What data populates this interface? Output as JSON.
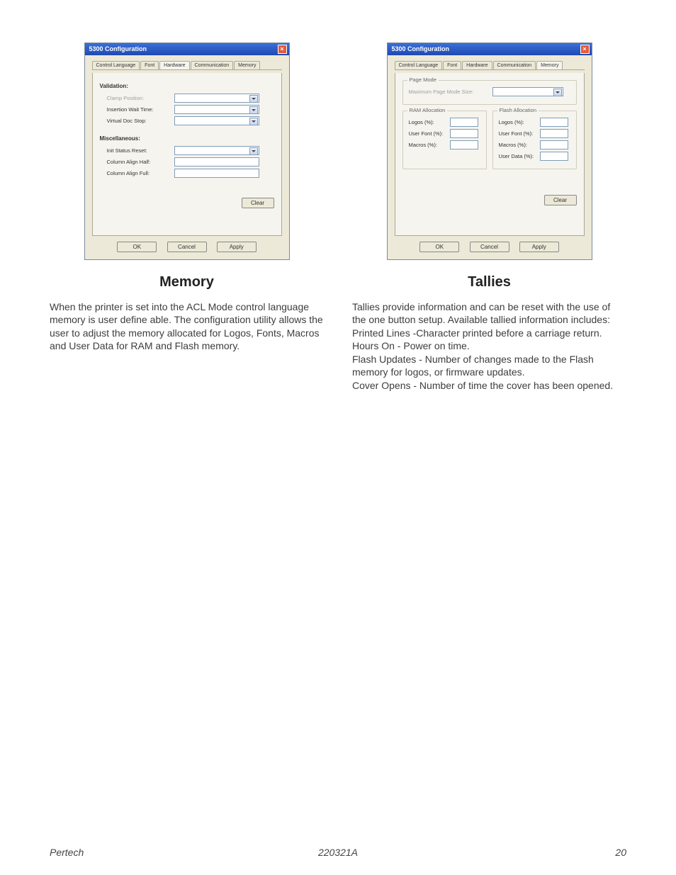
{
  "dialog_title": "5300 Configuration",
  "tabs": {
    "control_language": "Control Language",
    "font": "Font",
    "hardware": "Hardware",
    "communication": "Communication",
    "memory": "Memory"
  },
  "memory_tab": {
    "validation_section": "Validation:",
    "clamp_position": "Clamp Position:",
    "insertion_wait_time": "Insertion Wait Time:",
    "virtual Doc Stop": "Virtual Doc Stop:",
    "misc_section": "Miscellaneous:",
    "init_status_reset": "Init Status Reset:",
    "col_align_half": "Column Align Half:",
    "col_align_full": "Column Align Full:"
  },
  "tallies_tab": {
    "page_mode_legend": "Page Mode",
    "max_page_mode_size": "Maximum Page Mode Size:",
    "ram_legend": "RAM Allocation",
    "flash_legend": "Flash Allocation",
    "logos": "Logos (%):",
    "user_font": "User Font (%):",
    "macros": "Macros (%):",
    "user_data": "User Data (%):"
  },
  "buttons": {
    "clear": "Clear",
    "ok": "OK",
    "cancel": "Cancel",
    "apply": "Apply"
  },
  "headings": {
    "memory": "Memory",
    "tallies": "Tallies"
  },
  "body_memory": "When the printer is set into the ACL Mode control language memory is user define able. The configuration utility allows the user to adjust the memory allocated for Logos, Fonts, Macros and User Data for RAM and Flash memory.",
  "body_tallies_intro": "Tallies provide information and can be reset with the use of the one button setup. Available tallied information includes:",
  "body_tallies_lines": "Printed Lines -Character printed before a carriage return.",
  "body_tallies_hours": "Hours On - Power on time.",
  "body_tallies_flash": "Flash Updates - Number of changes made to the Flash memory for logos, or firmware updates.",
  "body_tallies_cover": "Cover Opens - Number of time the cover has been opened.",
  "footer": {
    "left": "Pertech",
    "center": "220321A",
    "right": "20"
  },
  "chart_data": null
}
